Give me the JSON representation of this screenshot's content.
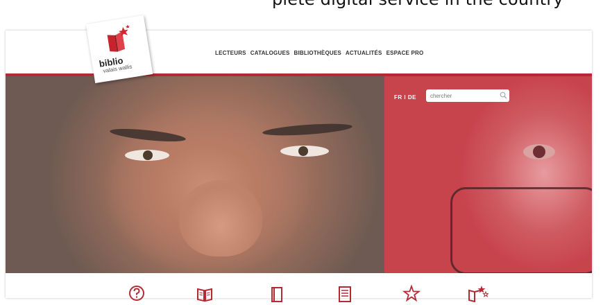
{
  "caption": "plete digital service in the country",
  "logo": {
    "title": "biblio",
    "subtitle": "valais wallis"
  },
  "nav": [
    {
      "label": "LECTEURS"
    },
    {
      "label": "CATALOGUES"
    },
    {
      "label": "BIBLIOTHÈQUES"
    },
    {
      "label": "ACTUALITÉS"
    },
    {
      "label": "ESPACE PRO"
    }
  ],
  "lang": {
    "label": "FR I DE"
  },
  "search": {
    "placeholder": "chercher"
  },
  "colors": {
    "brand_red": "#b32a35",
    "hero_red": "#c8444d"
  },
  "bottom_icons": [
    "help-icon",
    "open-book-icon",
    "book-icon",
    "document-icon",
    "star-icon",
    "book-star-icon"
  ]
}
